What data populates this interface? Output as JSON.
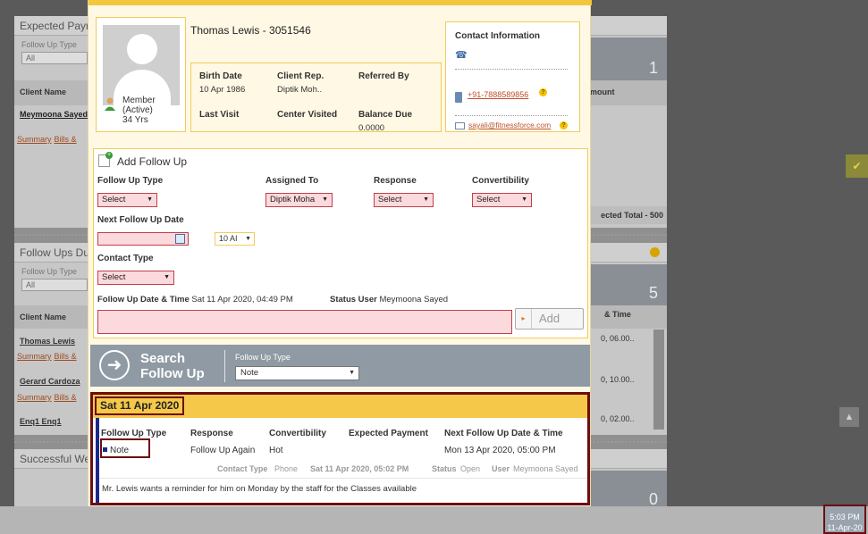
{
  "background": {
    "panel1": {
      "title": "Expected Payr",
      "sub": "Follow Up Type",
      "select": "All",
      "col1": "Client Name",
      "col2": "mount",
      "name1": "Meymoona Sayed",
      "link1": "Summary",
      "link2": "Bills &",
      "count": "1",
      "total": "ected Total - 500"
    },
    "panel2": {
      "title": "Follow Ups Du",
      "sub": "Follow Up Type",
      "select": "All",
      "col1": "Client Name",
      "col2": "& Time",
      "count": "5",
      "rows": [
        {
          "name": "Thomas Lewis",
          "time": "0, 06.00.."
        },
        {
          "name": "Gerard Cardoza",
          "time": "0, 10.00.."
        },
        {
          "name": "Enq1 Enq1",
          "time": "0, 02.00.."
        }
      ],
      "link1": "Summary",
      "link2": "Bills &"
    },
    "panel3": {
      "title": "Successful We",
      "count": "0"
    }
  },
  "profile": {
    "name": "Thomas Lewis - 3051546",
    "member_status": "Member",
    "member_active": "(Active)",
    "age": "34 Yrs",
    "birth_date_label": "Birth Date",
    "birth_date": "10 Apr 1986",
    "client_rep_label": "Client Rep.",
    "client_rep": "Diptik Moh..",
    "referred_by_label": "Referred By",
    "last_visit_label": "Last Visit",
    "center_visited_label": "Center Visited",
    "balance_due_label": "Balance Due",
    "balance_due": "0.0000"
  },
  "contact": {
    "title": "Contact Information",
    "phone": "+91-7888589856",
    "email": "sayali@fitnessforce.com"
  },
  "add_follow_up": {
    "title": "Add Follow Up",
    "follow_up_type_label": "Follow Up Type",
    "follow_up_type": "Select",
    "assigned_to_label": "Assigned To",
    "assigned_to": "Diptik Moha",
    "response_label": "Response",
    "response": "Select",
    "convertibility_label": "Convertibility",
    "convertibility": "Select",
    "next_date_label": "Next Follow Up Date",
    "time": "10 AI",
    "contact_type_label": "Contact Type",
    "contact_type": "Select",
    "date_time_label": "Follow Up Date & Time",
    "date_time": "Sat 11 Apr 2020, 04:49 PM",
    "status_user_label": "Status User",
    "status_user": "Meymoona Sayed",
    "add_button": "Add"
  },
  "search": {
    "title1": "Search",
    "title2": "Follow Up",
    "type_label": "Follow Up Type",
    "type_value": "Note"
  },
  "history": {
    "date": "Sat 11 Apr 2020",
    "headers": [
      "Follow Up Type",
      "Response",
      "Convertibility",
      "Expected Payment",
      "Next Follow Up Date & Time"
    ],
    "values": {
      "type": "Note",
      "response": "Follow Up Again",
      "convertibility": "Hot",
      "expected_payment": "",
      "next": "Mon 13 Apr 2020, 05:00 PM"
    },
    "contact_type_label": "Contact Type",
    "contact_type": "Phone",
    "logged": "Sat 11 Apr 2020, 05:02 PM",
    "status_label": "Status",
    "status": "Open",
    "user_label": "User",
    "user": "Meymoona Sayed",
    "note": "Mr. Lewis wants a reminder for him on Monday by the staff for the Classes available"
  },
  "clock": {
    "time": "5:03 PM",
    "date": "11-Apr-20"
  }
}
